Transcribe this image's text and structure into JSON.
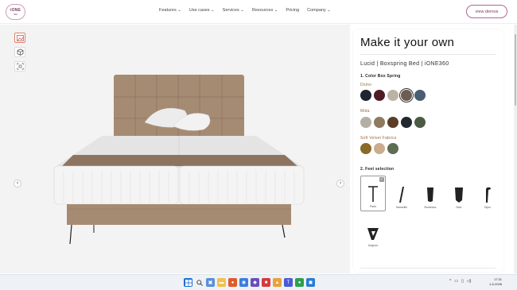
{
  "logo": {
    "line1": "iONE",
    "line2": "360"
  },
  "nav": {
    "links": [
      "Features ⌄",
      "Use cases ⌄",
      "Services ⌄",
      "Resources ⌄",
      "Pricing",
      "Company ⌄"
    ],
    "demo_button": "view demos"
  },
  "viewer": {
    "tools": [
      "gallery-icon",
      "cube-icon",
      "ar-scan-icon"
    ],
    "prev_arrow": "‹",
    "next_arrow": "›"
  },
  "panel": {
    "title": "Make it your own",
    "product": "Lucid | Boxspring Bed | iONE360",
    "section1": "1. Color Box Spring",
    "groups": [
      {
        "name": "Domo",
        "colors": [
          "#1e2530",
          "#4e1c26",
          "#bdb3a5",
          "#6a5d52",
          "#4a5d72"
        ],
        "selected": 3
      },
      {
        "name": "Mida",
        "colors": [
          "#b4afa6",
          "#8e7a5e",
          "#5a3d26",
          "#23282e",
          "#4c5a44"
        ],
        "selected": -1
      },
      {
        "name": "Soft Velvet Fabrics",
        "colors": [
          "#8a6a28",
          "#c9ad8c",
          "#5d6e52"
        ],
        "selected": -1
      }
    ],
    "section2": "2. Feet selection",
    "feet": [
      "Paris",
      "Marseille",
      "Bordeaux",
      "Nice",
      "Dijon"
    ],
    "feet_extra": "Avignon"
  },
  "taskbar": {
    "tray": [
      "^",
      "▭",
      "▯",
      "◁)"
    ],
    "time": "17:31",
    "date": "1-5-2026"
  }
}
